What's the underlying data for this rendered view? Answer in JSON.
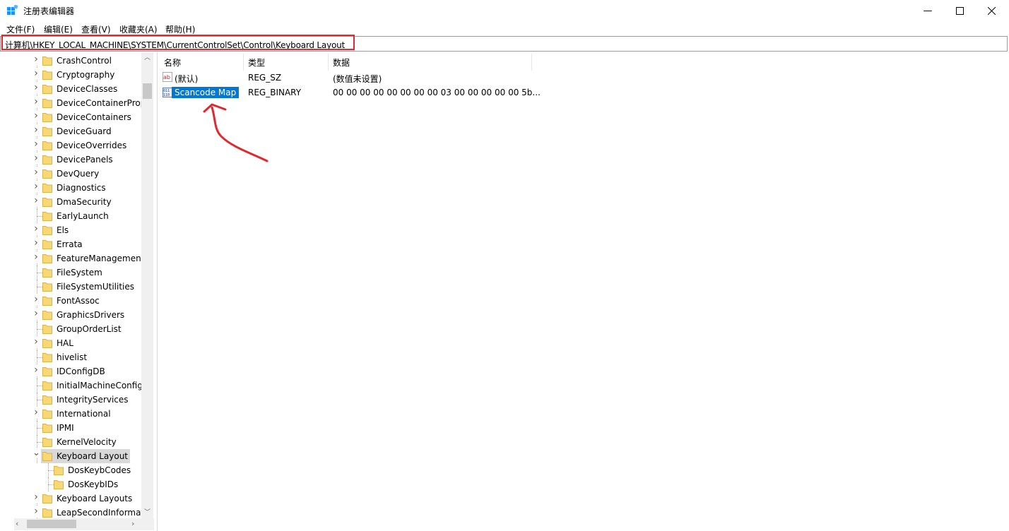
{
  "window": {
    "title": "注册表编辑器",
    "controls": {
      "minimize": "—",
      "maximize": "☐",
      "close": "✕"
    }
  },
  "menu": [
    "文件(F)",
    "编辑(E)",
    "查看(V)",
    "收藏夹(A)",
    "帮助(H)"
  ],
  "address": "计算机\\HKEY_LOCAL_MACHINE\\SYSTEM\\CurrentControlSet\\Control\\Keyboard Layout",
  "tree": [
    {
      "label": "CrashControl",
      "arrow": ">",
      "indent": 0
    },
    {
      "label": "Cryptography",
      "arrow": ">",
      "indent": 0
    },
    {
      "label": "DeviceClasses",
      "arrow": ">",
      "indent": 0
    },
    {
      "label": "DeviceContainerProp",
      "arrow": ">",
      "indent": 0
    },
    {
      "label": "DeviceContainers",
      "arrow": ">",
      "indent": 0
    },
    {
      "label": "DeviceGuard",
      "arrow": ">",
      "indent": 0
    },
    {
      "label": "DeviceOverrides",
      "arrow": ">",
      "indent": 0
    },
    {
      "label": "DevicePanels",
      "arrow": ">",
      "indent": 0
    },
    {
      "label": "DevQuery",
      "arrow": ">",
      "indent": 0
    },
    {
      "label": "Diagnostics",
      "arrow": ">",
      "indent": 0
    },
    {
      "label": "DmaSecurity",
      "arrow": ">",
      "indent": 0
    },
    {
      "label": "EarlyLaunch",
      "arrow": "",
      "indent": 0
    },
    {
      "label": "Els",
      "arrow": ">",
      "indent": 0
    },
    {
      "label": "Errata",
      "arrow": ">",
      "indent": 0
    },
    {
      "label": "FeatureManagement",
      "arrow": ">",
      "indent": 0
    },
    {
      "label": "FileSystem",
      "arrow": "",
      "indent": 0
    },
    {
      "label": "FileSystemUtilities",
      "arrow": "",
      "indent": 0
    },
    {
      "label": "FontAssoc",
      "arrow": ">",
      "indent": 0
    },
    {
      "label": "GraphicsDrivers",
      "arrow": ">",
      "indent": 0
    },
    {
      "label": "GroupOrderList",
      "arrow": "",
      "indent": 0
    },
    {
      "label": "HAL",
      "arrow": ">",
      "indent": 0
    },
    {
      "label": "hivelist",
      "arrow": "",
      "indent": 0
    },
    {
      "label": "IDConfigDB",
      "arrow": ">",
      "indent": 0
    },
    {
      "label": "InitialMachineConfig",
      "arrow": "",
      "indent": 0
    },
    {
      "label": "IntegrityServices",
      "arrow": "",
      "indent": 0
    },
    {
      "label": "International",
      "arrow": ">",
      "indent": 0
    },
    {
      "label": "IPMI",
      "arrow": "",
      "indent": 0
    },
    {
      "label": "KernelVelocity",
      "arrow": "",
      "indent": 0
    },
    {
      "label": "Keyboard Layout",
      "arrow": "v",
      "indent": 0,
      "selected": true
    },
    {
      "label": "DosKeybCodes",
      "arrow": "",
      "indent": 1
    },
    {
      "label": "DosKeybIDs",
      "arrow": "",
      "indent": 1
    },
    {
      "label": "Keyboard Layouts",
      "arrow": ">",
      "indent": 0
    },
    {
      "label": "LeapSecondInformat",
      "arrow": ">",
      "indent": 0
    }
  ],
  "columns": {
    "name": "名称",
    "type": "类型",
    "data": "数据"
  },
  "values": [
    {
      "name": "(默认)",
      "type": "REG_SZ",
      "data": "(数值未设置)",
      "icon": "string-value-icon"
    },
    {
      "name": "Scancode Map",
      "type": "REG_BINARY",
      "data": "00 00 00 00 00 00 00 00 03 00 00 00 00 00 5b...",
      "icon": "binary-value-icon",
      "selected": true
    }
  ],
  "colors": {
    "accent": "#0078d7",
    "annotation": "#e0282e",
    "folder": "#f8d775"
  }
}
